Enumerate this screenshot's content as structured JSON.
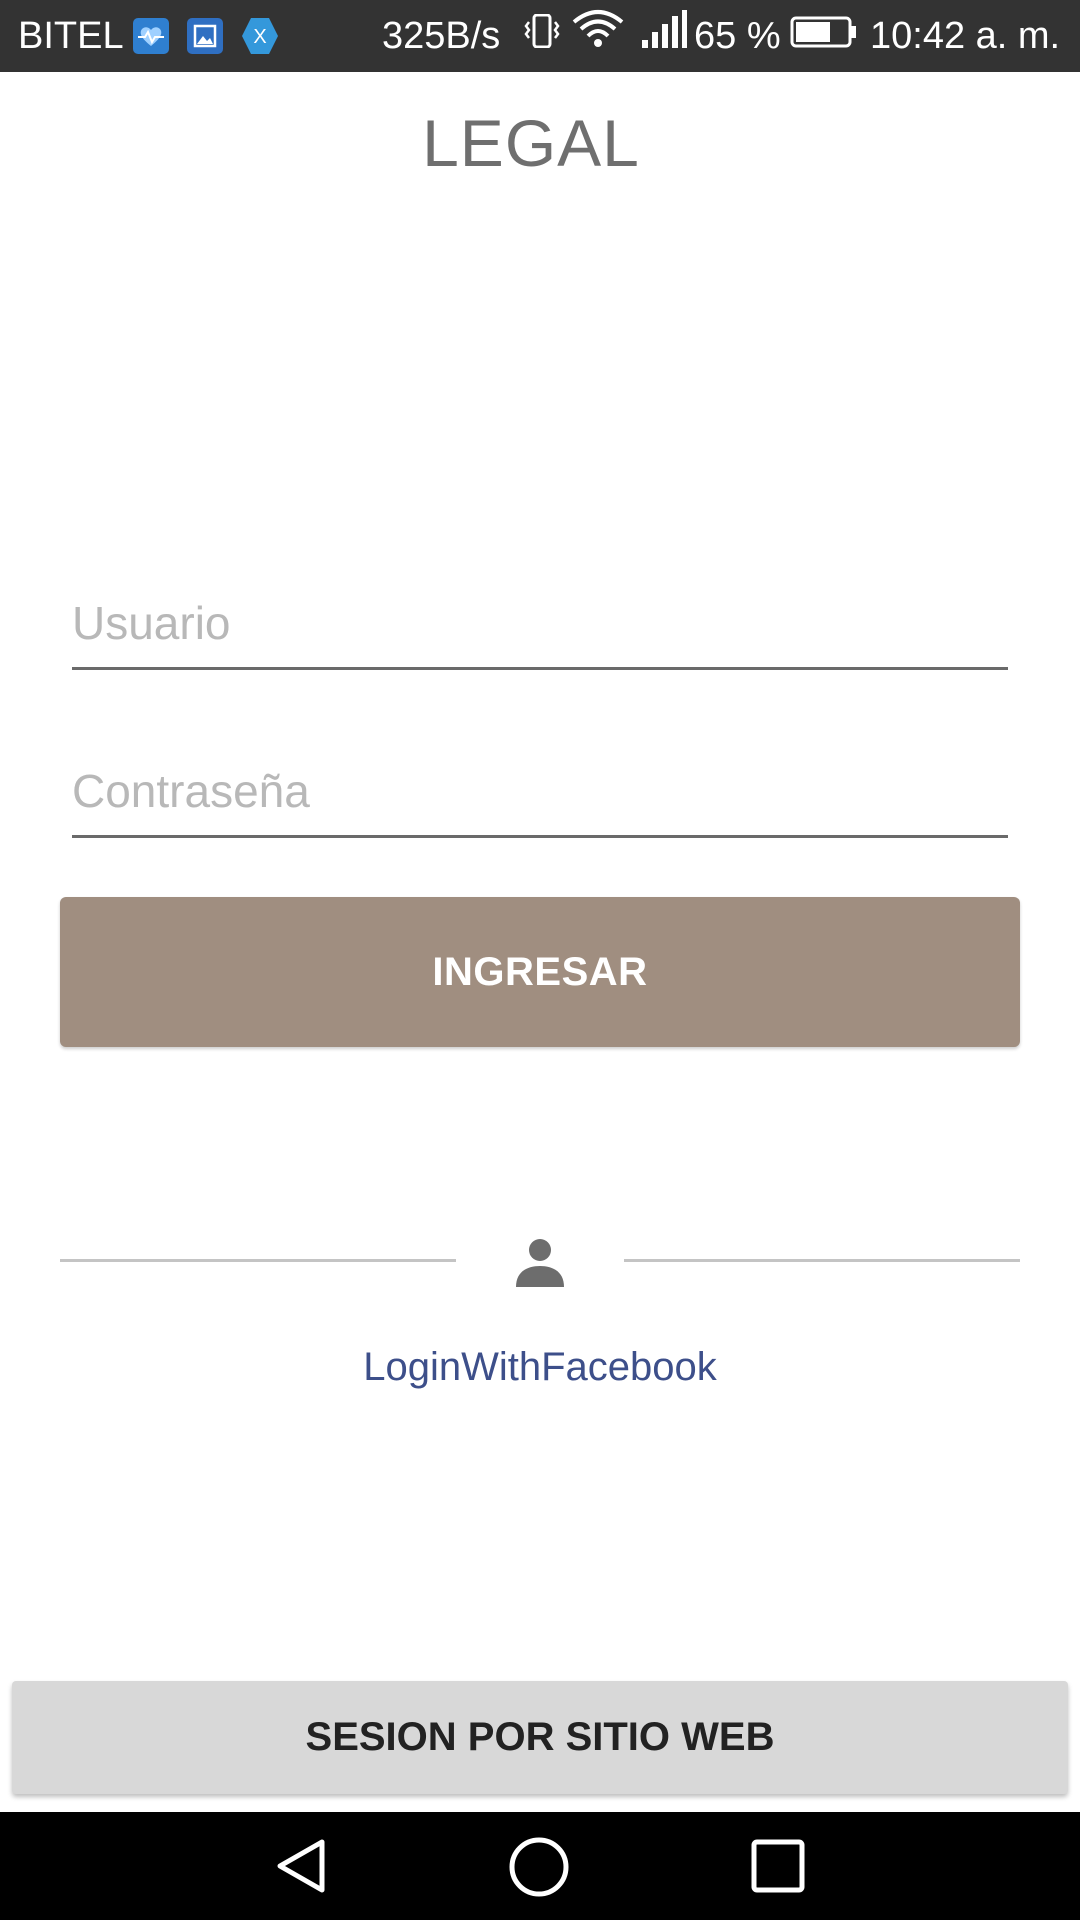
{
  "status_bar": {
    "carrier": "BITEL",
    "network_speed": "325B/s",
    "battery_percent": "65 %",
    "clock": "10:42 a. m.",
    "notification_icons": [
      "health-app-icon",
      "gallery-icon",
      "xamarin-icon"
    ],
    "system_icons": [
      "vibrate-icon",
      "wifi-icon",
      "signal-icon",
      "battery-icon"
    ],
    "xamarin_letter": "X"
  },
  "header": {
    "title": "LEGAL"
  },
  "form": {
    "username_placeholder": "Usuario",
    "username_value": "",
    "password_placeholder": "Contraseña",
    "password_value": "",
    "login_button_label": "INGRESAR"
  },
  "social": {
    "divider_icon": "person-icon",
    "facebook_link_label": "LoginWithFacebook"
  },
  "footer": {
    "web_session_button_label": "SESION POR SITIO WEB"
  },
  "nav_bar": {
    "buttons": [
      "back-icon",
      "home-icon",
      "recents-icon"
    ]
  },
  "colors": {
    "status_bar_bg": "#333333",
    "login_button_bg": "#a08e80",
    "link_color": "#3d4f8a",
    "web_button_bg": "#d8d8d8",
    "title_color": "#6f6f6f"
  }
}
